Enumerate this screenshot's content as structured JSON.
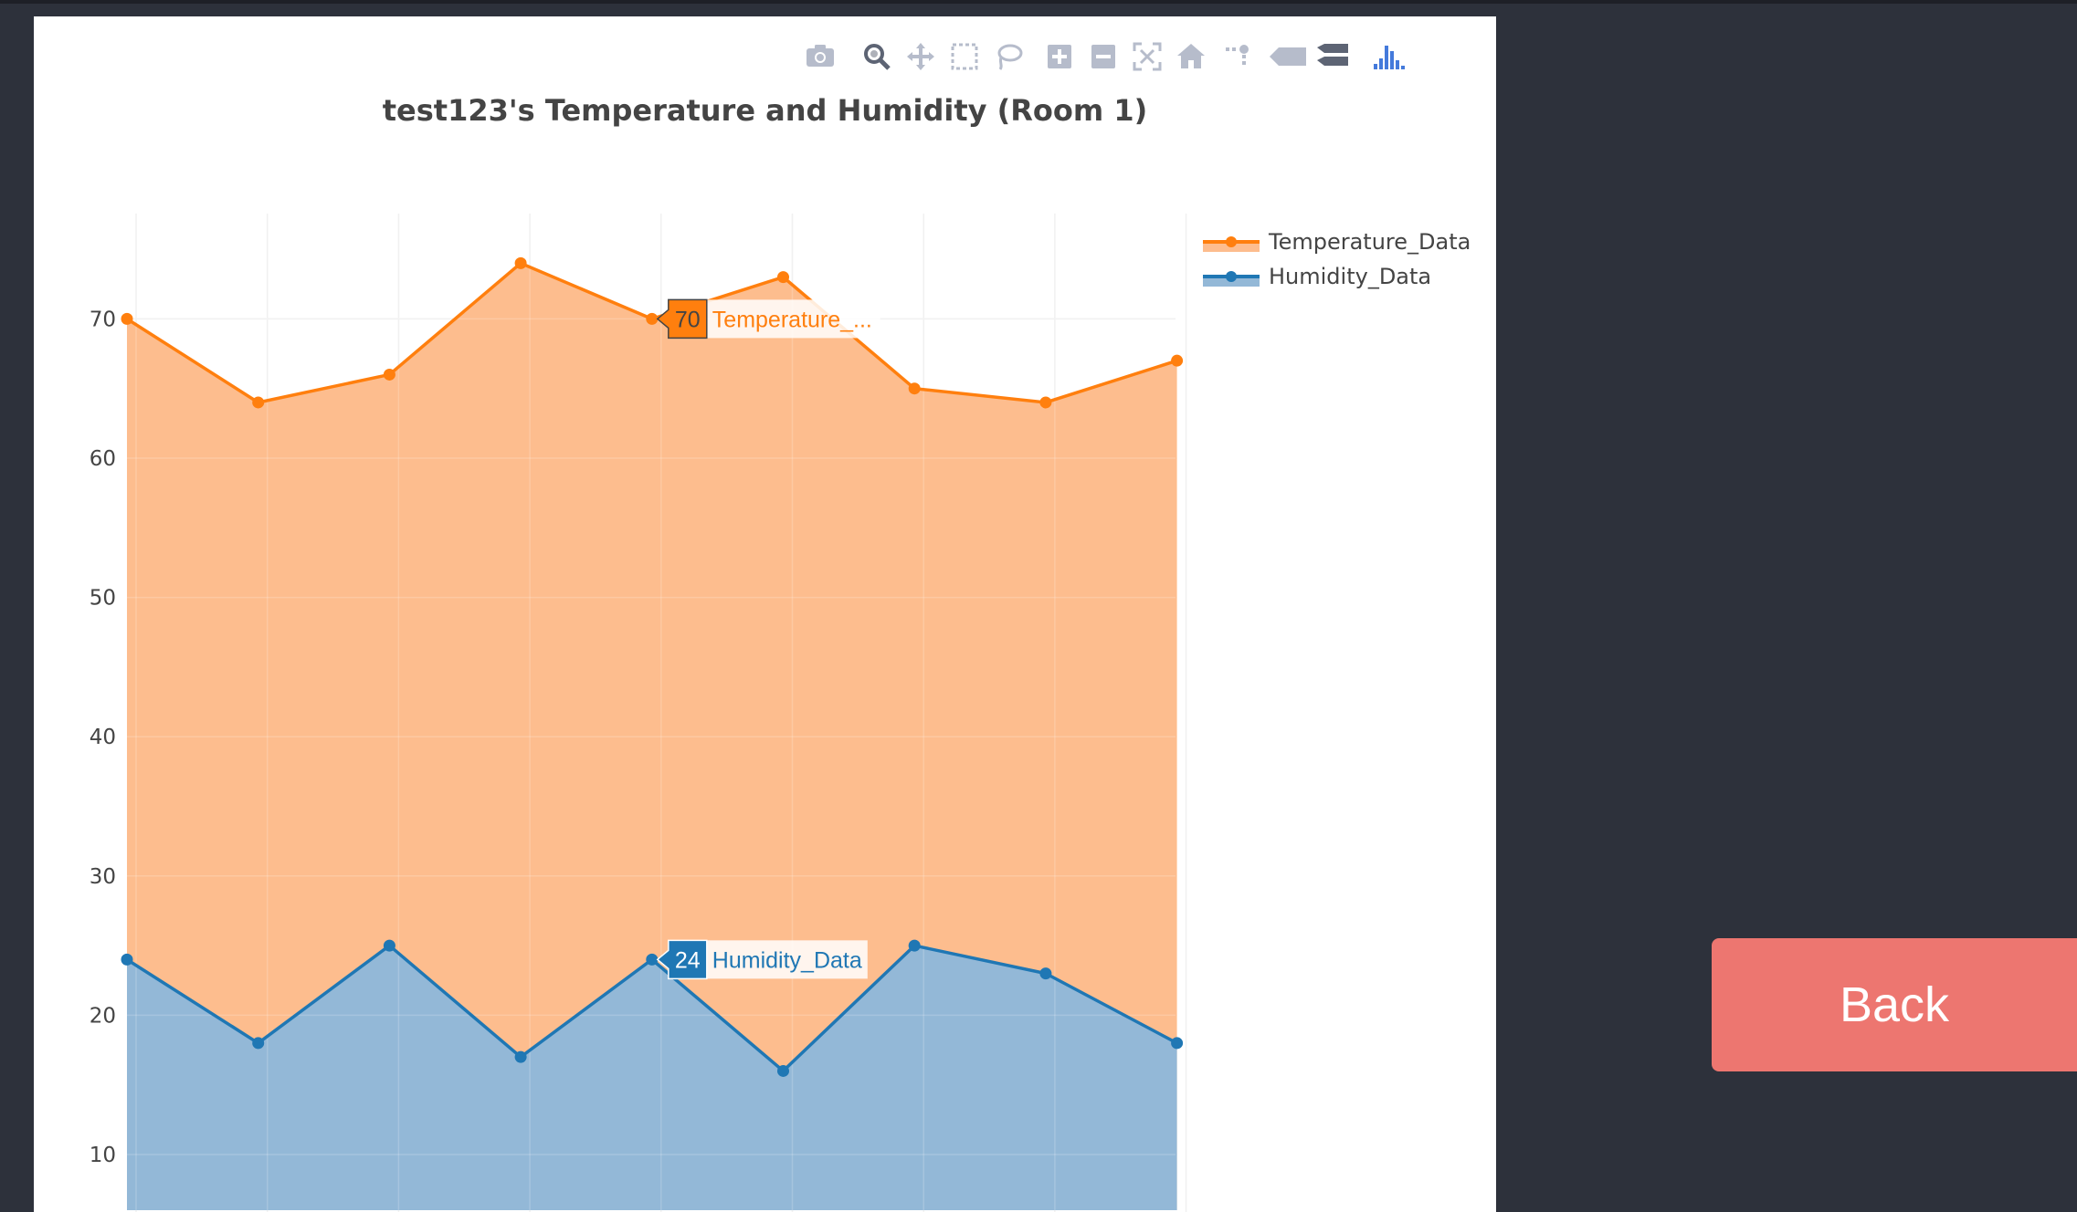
{
  "page": {
    "back_label": "Back"
  },
  "modebar": {
    "icons": [
      "camera-icon",
      "zoom-icon",
      "pan-icon",
      "box-select-icon",
      "lasso-select-icon",
      "zoom-in-icon",
      "zoom-out-icon",
      "autoscale-icon",
      "reset-axes-icon",
      "toggle-spikelines-icon",
      "hover-closest-icon",
      "hover-compare-icon",
      "plotly-logo-icon"
    ]
  },
  "chart_data": {
    "type": "area",
    "title": "test123's Temperature and Humidity (Room 1)",
    "xlabel": "",
    "ylabel": "",
    "y_ticks": [
      10,
      20,
      30,
      40,
      50,
      60,
      70
    ],
    "ylim": [
      6,
      79
    ],
    "x": [
      0,
      1,
      2,
      3,
      4,
      5,
      6,
      7,
      8
    ],
    "grid": true,
    "legend_position": "top-right",
    "series": [
      {
        "name": "Temperature_Data",
        "color": "#ff7f0e",
        "fill": "#fdbd8e",
        "values": [
          70,
          64,
          66,
          74,
          70,
          73,
          65,
          64,
          67
        ]
      },
      {
        "name": "Humidity_Data",
        "color": "#1f77b4",
        "fill": "#93b8d7",
        "values": [
          24,
          18,
          25,
          17,
          24,
          16,
          25,
          23,
          18
        ]
      }
    ],
    "hover": [
      {
        "series": 0,
        "index": 4,
        "value": "70",
        "label": "Temperature_..."
      },
      {
        "series": 1,
        "index": 4,
        "value": "24",
        "label": "Humidity_Data"
      }
    ]
  }
}
